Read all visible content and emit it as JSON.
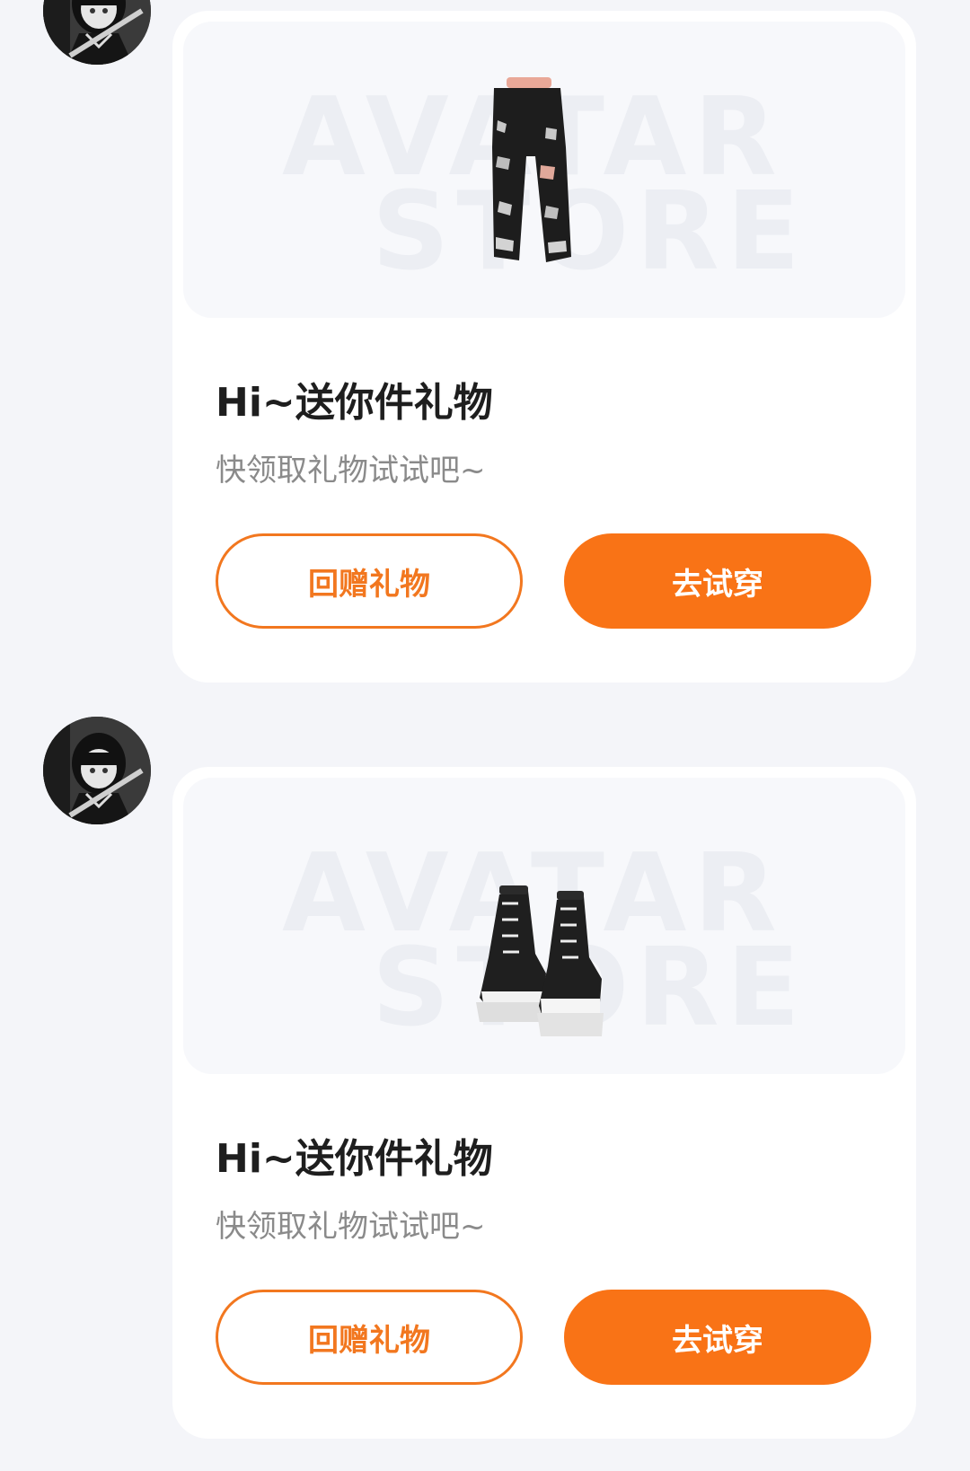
{
  "theme": {
    "accent": "#F97316",
    "background": "#F4F5F9",
    "card": "#FFFFFF"
  },
  "messages": [
    {
      "item_icon": "ripped-jeans-icon",
      "watermark_line1": "AVATAR",
      "watermark_line2": "STORE",
      "title": "Hi~送你件礼物",
      "subtitle": "快领取礼物试试吧~",
      "return_gift_label": "回赠礼物",
      "try_on_label": "去试穿"
    },
    {
      "item_icon": "high-top-sneakers-icon",
      "watermark_line1": "AVATAR",
      "watermark_line2": "STORE",
      "title": "Hi~送你件礼物",
      "subtitle": "快领取礼物试试吧~",
      "return_gift_label": "回赠礼物",
      "try_on_label": "去试穿"
    }
  ]
}
